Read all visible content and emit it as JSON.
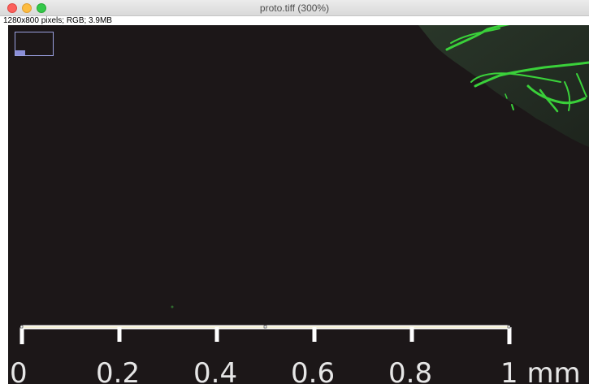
{
  "window": {
    "title": "proto.tiff (300%)",
    "info": "1280x800 pixels; RGB; 3.9MB"
  },
  "controls": {
    "close": "close-window",
    "minimize": "minimize-window",
    "zoom": "zoom-window"
  },
  "image": {
    "background_color": "#1c1718",
    "fluorescence_color": "#3ad13a"
  },
  "scale_bar": {
    "ticks": [
      "0",
      "0.2",
      "0.4",
      "0.6",
      "0.8",
      "1 mm"
    ]
  }
}
